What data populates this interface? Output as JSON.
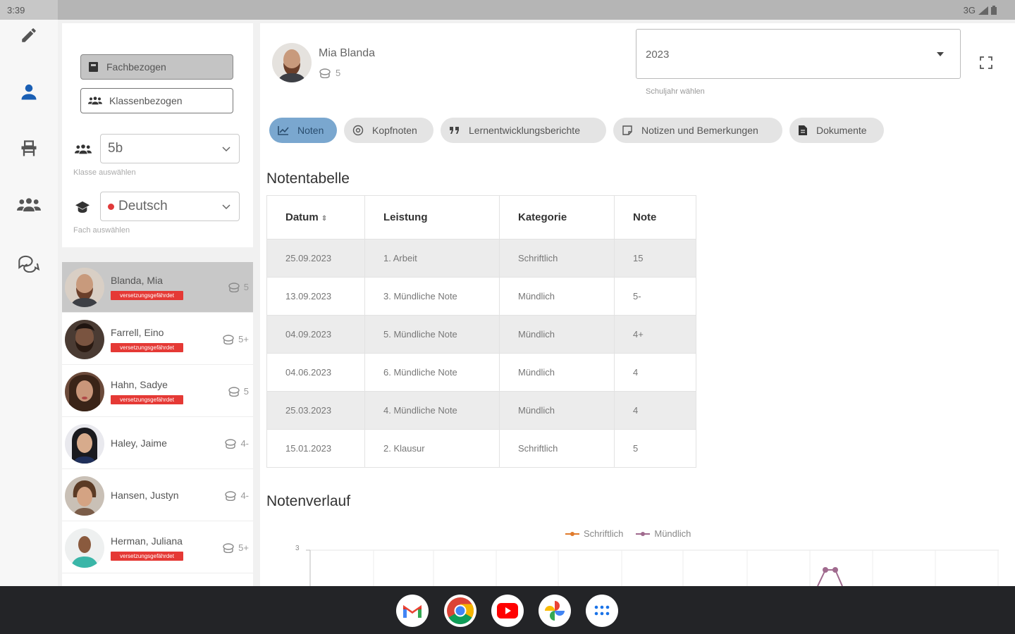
{
  "status_bar": {
    "time": "3:39",
    "network": "3G"
  },
  "nav_rail": {
    "items": [
      "edit",
      "student",
      "school",
      "group",
      "chat"
    ]
  },
  "view_toggle": {
    "subject_label": "Fachbezogen",
    "class_label": "Klassenbezogen"
  },
  "class_select": {
    "value": "5b",
    "hint": "Klasse auswählen"
  },
  "subject_select": {
    "value": "Deutsch",
    "hint": "Fach auswählen",
    "color": "#e03a3a"
  },
  "students": [
    {
      "name": "Blanda, Mia",
      "badge": "versetzungsgefährdet",
      "grade": "5",
      "active": true
    },
    {
      "name": "Farrell, Eino",
      "badge": "versetzungsgefährdet",
      "grade": "5+"
    },
    {
      "name": "Hahn, Sadye",
      "badge": "versetzungsgefährdet",
      "grade": "5"
    },
    {
      "name": "Haley, Jaime",
      "badge": "",
      "grade": "4-"
    },
    {
      "name": "Hansen, Justyn",
      "badge": "",
      "grade": "4-"
    },
    {
      "name": "Herman, Juliana",
      "badge": "versetzungsgefährdet",
      "grade": "5+"
    }
  ],
  "profile": {
    "name": "Mia Blanda",
    "grade": "5"
  },
  "year_select": {
    "value": "2023",
    "hint": "Schuljahr wählen"
  },
  "tabs": [
    {
      "label": "Noten",
      "active": true
    },
    {
      "label": "Kopfnoten"
    },
    {
      "label": "Lernentwicklungsberichte"
    },
    {
      "label": "Notizen und Bemerkungen"
    },
    {
      "label": "Dokumente"
    }
  ],
  "grade_table": {
    "title": "Notentabelle",
    "headers": [
      "Datum",
      "Leistung",
      "Kategorie",
      "Note"
    ],
    "rows": [
      [
        "25.09.2023",
        "1. Arbeit",
        "Schriftlich",
        "15"
      ],
      [
        "13.09.2023",
        "3. Mündliche Note",
        "Mündlich",
        "5-"
      ],
      [
        "04.09.2023",
        "5. Mündliche Note",
        "Mündlich",
        "4+"
      ],
      [
        "04.06.2023",
        "6. Mündliche Note",
        "Mündlich",
        "4"
      ],
      [
        "25.03.2023",
        "4. Mündliche Note",
        "Mündlich",
        "4"
      ],
      [
        "15.01.2023",
        "2. Klausur",
        "Schriftlich",
        "5"
      ]
    ]
  },
  "grade_chart": {
    "title": "Notenverlauf",
    "legend": [
      {
        "label": "Schriftlich",
        "color": "#e07b2c"
      },
      {
        "label": "Mündlich",
        "color": "#a06a8e"
      }
    ],
    "y_tick": "3"
  },
  "taskbar": {
    "apps": [
      "gmail",
      "chrome",
      "youtube",
      "photos",
      "apps"
    ]
  }
}
